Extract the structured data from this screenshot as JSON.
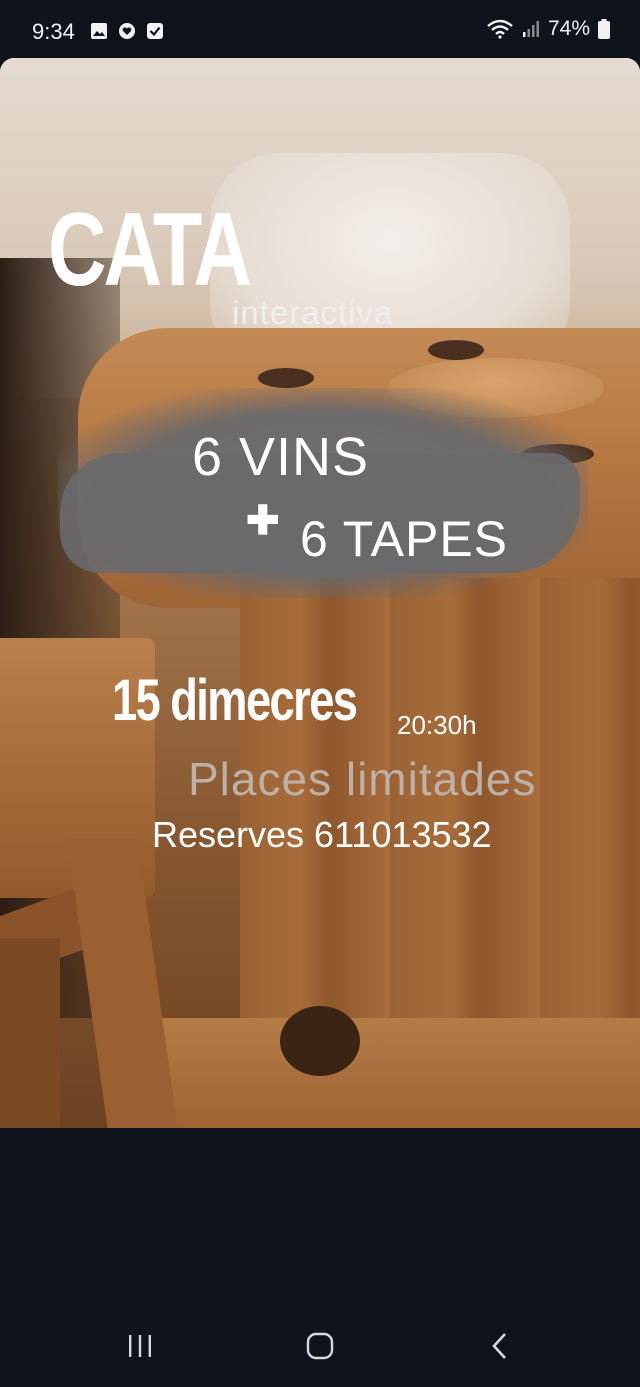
{
  "status_bar": {
    "time": "9:34",
    "battery": "74%",
    "icons": [
      "gallery-icon",
      "heart-badge-icon",
      "checkbox-icon",
      "wifi-icon",
      "signal-icon",
      "battery-icon"
    ]
  },
  "story": {
    "headline": "CATA",
    "headline_sub": "interactiva",
    "line_vins": "6 VINS",
    "plus_sign": "✚",
    "line_tapes": "6 TAPES",
    "date": "15 dimecres",
    "time": "20:30h",
    "places": "Places limitades",
    "reserves": "Reserves 611013532"
  },
  "nav_bar": {
    "buttons": [
      "recents-icon",
      "home-icon",
      "back-icon"
    ]
  },
  "colors": {
    "background": "#0f131c",
    "brush": "#69696d",
    "places_text": "#bdb0a6"
  }
}
